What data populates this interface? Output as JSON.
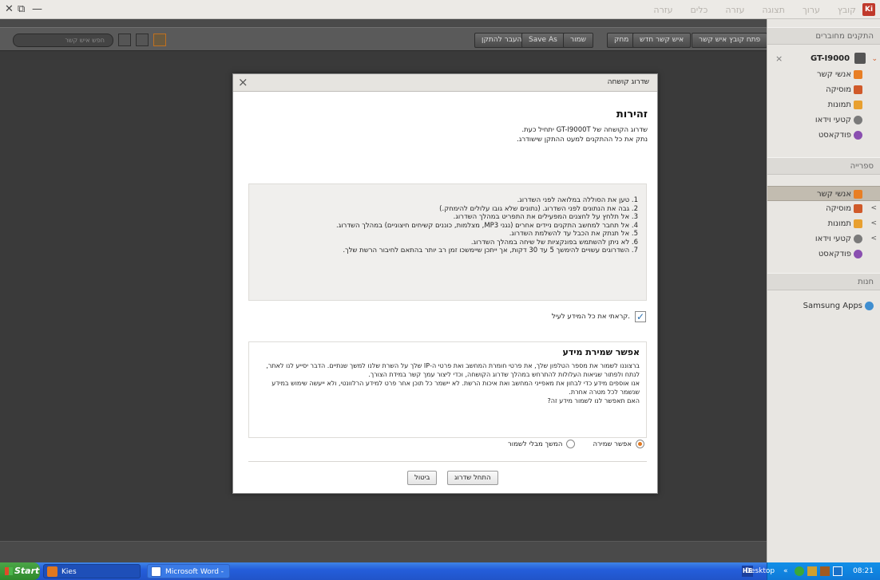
{
  "window": {
    "menu": [
      "קובץ",
      "ערוך",
      "תצוגה",
      "עזרה",
      "כלים",
      "עזרה"
    ],
    "controls": {
      "close": "✕",
      "restore": "⧉",
      "minimize": "—"
    }
  },
  "toolbar": {
    "open_contacts": "פתח קובץ איש קשר",
    "new_contact": "איש קשר חדש",
    "delete": "מחק",
    "save": "שמור",
    "save_as": "Save As",
    "move_to_device": "העבר להתקן",
    "search_placeholder": "חפש איש קשר"
  },
  "sidebar": {
    "connected_header": "התקנים מחוברים",
    "device": {
      "name": "GT-I9000",
      "disconnect": "×"
    },
    "device_items": [
      "אנשי קשר",
      "מוסיקה",
      "תמונות",
      "קטעי וידאו",
      "פודקאסט"
    ],
    "library_header": "ספרייה",
    "library_items": [
      "אנשי קשר",
      "מוסיקה",
      "תמונות",
      "קטעי וידאו",
      "פודקאסט"
    ],
    "store_header": "חנות",
    "store_items": [
      "Samsung Apps"
    ],
    "colors": {
      "contacts": "#e87f25",
      "music": "#d05a2a",
      "photos": "#e8a030",
      "video": "#7a7a7a",
      "podcast": "#8a4fb0",
      "apps": "#3f8ed0"
    }
  },
  "dialog": {
    "title": "שדרוג קושחה",
    "close": "×",
    "warning_title": "זהירות",
    "warning_lines": [
      "שדרוג הקושחה של GT-I9000T יתחיל כעת.",
      "נתק את כל ההתקנים למעט ההתקן שישודרג."
    ],
    "steps": [
      "1. טען את הסוללה במלואה לפני השדרוג.",
      "2. גבה את הנתונים לפני השדרוג. (נתונים שלא גובו עלולים להימחק.)",
      "3. אל תלחץ על לחצנים המפעילים את התפריט במהלך השדרוג.",
      "4. אל תחבר למחשב התקנים ניידים אחרים (נגני MP3, מצלמות, כוננים קשיחים חיצוניים) במהלך השדרוג.",
      "5. אל תנתק את הכבל עד להשלמת השדרוג.",
      "6. לא ניתן להשתמש בפונקציות של שיחה במהלך השדרוג.",
      "7. השדרוגים עשויים להימשך 5 עד 30 דקות, אך ייתכן שיימשכו זמן רב יותר בהתאם לחיבור הרשת שלך."
    ],
    "checkbox_label": "קראתי את כל המידע לעיל.",
    "checkbox_checked": true,
    "privacy_title": "אפשר שמירת מידע",
    "privacy_lines": [
      "ברצוננו לשמור את מספר הטלפון שלך, את פרטי חומרת המחשב ואת פרטי ה-IP שלך על השרת שלנו למשך שנתיים. הדבר יסייע לנו לאתר,",
      "לנתח ולפתור שגיאות העלולות להתרחש במהלך שדרוג הקושחה, וכדי ליצור עמך קשר במידת הצורך.",
      "אנו אוספים מידע כדי לבחון את מאפייני המחשב ואת איכות הרשת. לא יישמר כל תוכן אחר פרט למידע הרלוונטי, ולא ייעשה שימוש במידע",
      "שנשמר לכל מטרה אחרת.",
      "האם תאפשר לנו לשמור מידע זה?"
    ],
    "radio_allow": "אפשר שמירה",
    "radio_continue": "המשך מבלי לשמור",
    "radio_selected": "allow",
    "start_button": "התחל שדרוג",
    "cancel_button": "ביטול"
  },
  "taskbar": {
    "start": "Start",
    "tasks": [
      "Kies",
      "Microsoft Word - Docum..."
    ],
    "lang": "HE",
    "desktop": "Desktop",
    "clock": "08:21"
  }
}
